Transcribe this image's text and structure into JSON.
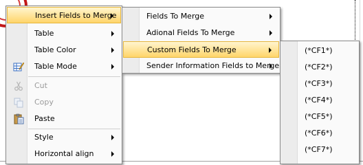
{
  "context_menu": {
    "insert_fields": "Insert Fields to Merge",
    "table": "Table",
    "table_color": "Table Color",
    "table_mode": "Table Mode",
    "cut": "Cut",
    "copy": "Copy",
    "paste": "Paste",
    "style": "Style",
    "horizontal_align": "Horizontal align"
  },
  "fields_submenu": {
    "fields_to_merge": "Fields To Merge",
    "additional_fields": "Adional Fields To Merge",
    "custom_fields": "Custom Fields To Merge",
    "sender_info": "Sender Information Fields to Merge"
  },
  "custom_fields_submenu": {
    "items": [
      "(*CF1*)",
      "(*CF2*)",
      "(*CF3*)",
      "(*CF4*)",
      "(*CF5*)",
      "(*CF6*)",
      "(*CF7*)"
    ]
  },
  "colors": {
    "highlight_top": "#fff5cf",
    "highlight_bottom": "#ffd56a",
    "highlight_border": "#e5b53c",
    "disabled_text": "#9b9b9b"
  },
  "icons": {
    "table_mode": "table-mode-icon",
    "cut": "scissors-icon",
    "copy": "copy-icon",
    "paste": "clipboard-icon"
  }
}
